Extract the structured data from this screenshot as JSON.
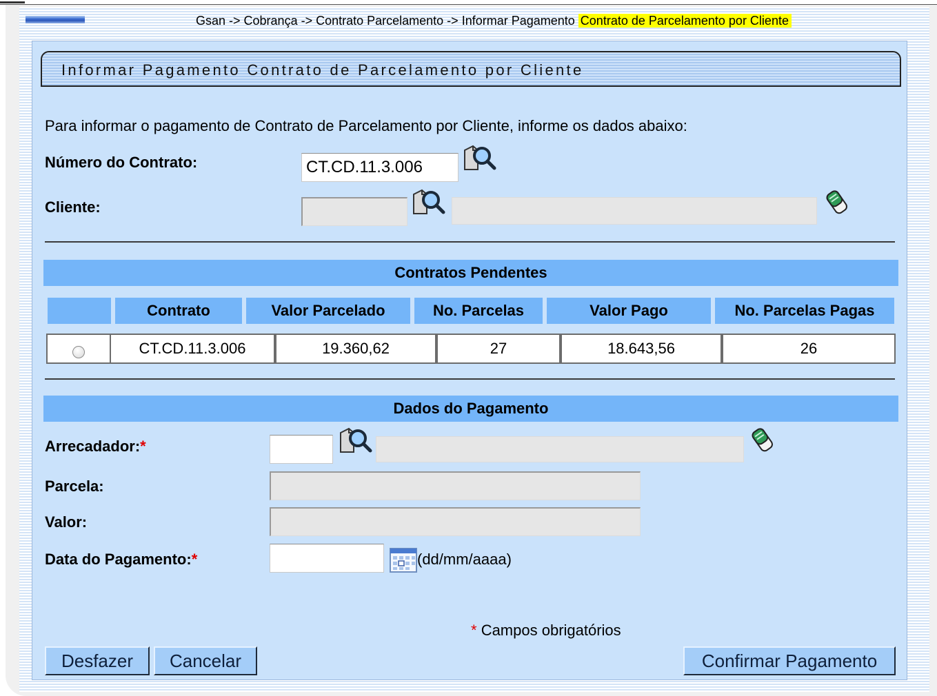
{
  "breadcrumb": {
    "path": "Gsan -> Cobrança -> Contrato Parcelamento -> Informar Pagamento",
    "highlight": "Contrato de Parcelamento por Cliente"
  },
  "page_title": "Informar Pagamento Contrato de Parcelamento por Cliente",
  "intro_text": "Para informar o pagamento de Contrato de Parcelamento por Cliente, informe os dados abaixo:",
  "form": {
    "numero_contrato": {
      "label": "Número do Contrato:",
      "value": "CT.CD.11.3.006"
    },
    "cliente": {
      "label": "Cliente:",
      "code": "",
      "name": ""
    }
  },
  "contratos_pendentes": {
    "title": "Contratos Pendentes",
    "columns": [
      "",
      "Contrato",
      "Valor Parcelado",
      "No. Parcelas",
      "Valor Pago",
      "No. Parcelas Pagas"
    ],
    "rows": [
      {
        "contrato": "CT.CD.11.3.006",
        "valor_parcelado": "19.360,62",
        "no_parcelas": "27",
        "valor_pago": "18.643,56",
        "no_parcelas_pagas": "26",
        "selected": false
      }
    ]
  },
  "dados_pagamento": {
    "title": "Dados do Pagamento",
    "arrecadador": {
      "label": "Arrecadador:",
      "required_mark": "*",
      "code": "",
      "name": ""
    },
    "parcela": {
      "label": "Parcela:",
      "value": ""
    },
    "valor": {
      "label": "Valor:",
      "value": ""
    },
    "data_pagamento": {
      "label": "Data do Pagamento:",
      "required_mark": "*",
      "value": "",
      "format_hint": "(dd/mm/aaaa)"
    }
  },
  "required_note": {
    "mark": "*",
    "text": "Campos obrigatórios"
  },
  "buttons": {
    "desfazer": "Desfazer",
    "cancelar": "Cancelar",
    "confirmar": "Confirmar Pagamento"
  },
  "icons": {
    "search": "magnifier-document-icon",
    "eraser": "eraser-icon",
    "calendar": "calendar-icon"
  },
  "colors": {
    "panel_bg": "#cae2fb",
    "section_bar": "#74b5f9",
    "breadcrumb_highlight": "#ffff00",
    "required": "#e00000"
  }
}
